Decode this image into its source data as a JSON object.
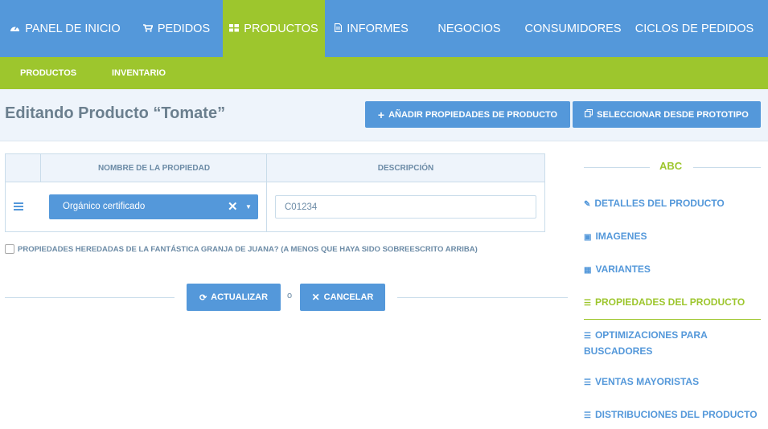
{
  "topnav": {
    "items": [
      {
        "label": "PANEL DE INICIO",
        "icon": "dashboard-icon"
      },
      {
        "label": "PEDIDOS",
        "icon": "cart-icon"
      },
      {
        "label": "PRODUCTOS",
        "icon": "grid-icon",
        "active": true
      },
      {
        "label": "INFORMES",
        "icon": "file-icon"
      },
      {
        "label": "NEGOCIOS"
      },
      {
        "label": "CONSUMIDORES"
      },
      {
        "label": "CICLOS DE PEDIDOS"
      }
    ]
  },
  "subnav": {
    "items": [
      {
        "label": "PRODUCTOS",
        "active": true
      },
      {
        "label": "INVENTARIO"
      }
    ]
  },
  "page": {
    "title": "Editando Producto “Tomate”",
    "add_properties_label": "AÑADIR PROPIEDADES DE PRODUCTO",
    "select_prototype_label": "SELECCIONAR DESDE PROTOTIPO"
  },
  "table": {
    "headers": [
      "NOMBRE DE LA PROPIEDAD",
      "DESCRIPCIÓN"
    ],
    "rows": [
      {
        "property": "Orgánico certificado",
        "description": "C01234"
      }
    ]
  },
  "inherit_label": "PROPIEDADES HEREDADAS DE LA FANTÁSTICA GRANJA DE JUANA? (A MENOS QUE HAYA SIDO SOBREESCRITO ARRIBA)",
  "actions": {
    "update_label": "ACTUALIZAR",
    "or_label": "o",
    "cancel_label": "CANCELAR"
  },
  "sidebar": {
    "title": "ABC",
    "links": [
      {
        "label": "DETALLES DEL PRODUCTO",
        "icon": "edit-icon"
      },
      {
        "label": "IMAGENES",
        "icon": "image-icon"
      },
      {
        "label": "VARIANTES",
        "icon": "grid-icon"
      },
      {
        "label": "PROPIEDADES DEL PRODUCTO",
        "icon": "list-icon",
        "active": true
      },
      {
        "label": "OPTIMIZACIONES PARA BUSCADORES",
        "icon": "list-icon"
      },
      {
        "label": "VENTAS MAYORISTAS",
        "icon": "list-icon"
      },
      {
        "label": "DISTRIBUCIONES DEL PRODUCTO",
        "icon": "list-icon"
      }
    ]
  },
  "colors": {
    "primary": "#5498da",
    "accent": "#9dc62d",
    "title_text": "#6b7f8e",
    "muted_text": "#6c8ba6"
  }
}
